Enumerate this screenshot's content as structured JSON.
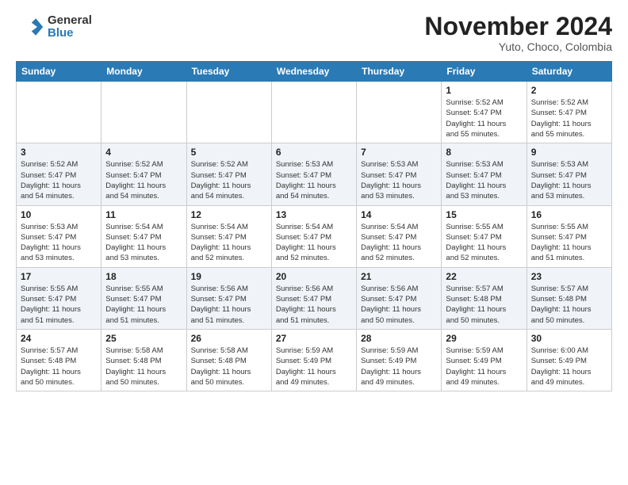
{
  "header": {
    "logo": {
      "general": "General",
      "blue": "Blue"
    },
    "title": "November 2024",
    "subtitle": "Yuto, Choco, Colombia"
  },
  "calendar": {
    "columns": [
      "Sunday",
      "Monday",
      "Tuesday",
      "Wednesday",
      "Thursday",
      "Friday",
      "Saturday"
    ],
    "weeks": [
      [
        {
          "day": "",
          "info": ""
        },
        {
          "day": "",
          "info": ""
        },
        {
          "day": "",
          "info": ""
        },
        {
          "day": "",
          "info": ""
        },
        {
          "day": "",
          "info": ""
        },
        {
          "day": "1",
          "info": "Sunrise: 5:52 AM\nSunset: 5:47 PM\nDaylight: 11 hours\nand 55 minutes."
        },
        {
          "day": "2",
          "info": "Sunrise: 5:52 AM\nSunset: 5:47 PM\nDaylight: 11 hours\nand 55 minutes."
        }
      ],
      [
        {
          "day": "3",
          "info": "Sunrise: 5:52 AM\nSunset: 5:47 PM\nDaylight: 11 hours\nand 54 minutes."
        },
        {
          "day": "4",
          "info": "Sunrise: 5:52 AM\nSunset: 5:47 PM\nDaylight: 11 hours\nand 54 minutes."
        },
        {
          "day": "5",
          "info": "Sunrise: 5:52 AM\nSunset: 5:47 PM\nDaylight: 11 hours\nand 54 minutes."
        },
        {
          "day": "6",
          "info": "Sunrise: 5:53 AM\nSunset: 5:47 PM\nDaylight: 11 hours\nand 54 minutes."
        },
        {
          "day": "7",
          "info": "Sunrise: 5:53 AM\nSunset: 5:47 PM\nDaylight: 11 hours\nand 53 minutes."
        },
        {
          "day": "8",
          "info": "Sunrise: 5:53 AM\nSunset: 5:47 PM\nDaylight: 11 hours\nand 53 minutes."
        },
        {
          "day": "9",
          "info": "Sunrise: 5:53 AM\nSunset: 5:47 PM\nDaylight: 11 hours\nand 53 minutes."
        }
      ],
      [
        {
          "day": "10",
          "info": "Sunrise: 5:53 AM\nSunset: 5:47 PM\nDaylight: 11 hours\nand 53 minutes."
        },
        {
          "day": "11",
          "info": "Sunrise: 5:54 AM\nSunset: 5:47 PM\nDaylight: 11 hours\nand 53 minutes."
        },
        {
          "day": "12",
          "info": "Sunrise: 5:54 AM\nSunset: 5:47 PM\nDaylight: 11 hours\nand 52 minutes."
        },
        {
          "day": "13",
          "info": "Sunrise: 5:54 AM\nSunset: 5:47 PM\nDaylight: 11 hours\nand 52 minutes."
        },
        {
          "day": "14",
          "info": "Sunrise: 5:54 AM\nSunset: 5:47 PM\nDaylight: 11 hours\nand 52 minutes."
        },
        {
          "day": "15",
          "info": "Sunrise: 5:55 AM\nSunset: 5:47 PM\nDaylight: 11 hours\nand 52 minutes."
        },
        {
          "day": "16",
          "info": "Sunrise: 5:55 AM\nSunset: 5:47 PM\nDaylight: 11 hours\nand 51 minutes."
        }
      ],
      [
        {
          "day": "17",
          "info": "Sunrise: 5:55 AM\nSunset: 5:47 PM\nDaylight: 11 hours\nand 51 minutes."
        },
        {
          "day": "18",
          "info": "Sunrise: 5:55 AM\nSunset: 5:47 PM\nDaylight: 11 hours\nand 51 minutes."
        },
        {
          "day": "19",
          "info": "Sunrise: 5:56 AM\nSunset: 5:47 PM\nDaylight: 11 hours\nand 51 minutes."
        },
        {
          "day": "20",
          "info": "Sunrise: 5:56 AM\nSunset: 5:47 PM\nDaylight: 11 hours\nand 51 minutes."
        },
        {
          "day": "21",
          "info": "Sunrise: 5:56 AM\nSunset: 5:47 PM\nDaylight: 11 hours\nand 50 minutes."
        },
        {
          "day": "22",
          "info": "Sunrise: 5:57 AM\nSunset: 5:48 PM\nDaylight: 11 hours\nand 50 minutes."
        },
        {
          "day": "23",
          "info": "Sunrise: 5:57 AM\nSunset: 5:48 PM\nDaylight: 11 hours\nand 50 minutes."
        }
      ],
      [
        {
          "day": "24",
          "info": "Sunrise: 5:57 AM\nSunset: 5:48 PM\nDaylight: 11 hours\nand 50 minutes."
        },
        {
          "day": "25",
          "info": "Sunrise: 5:58 AM\nSunset: 5:48 PM\nDaylight: 11 hours\nand 50 minutes."
        },
        {
          "day": "26",
          "info": "Sunrise: 5:58 AM\nSunset: 5:48 PM\nDaylight: 11 hours\nand 50 minutes."
        },
        {
          "day": "27",
          "info": "Sunrise: 5:59 AM\nSunset: 5:49 PM\nDaylight: 11 hours\nand 49 minutes."
        },
        {
          "day": "28",
          "info": "Sunrise: 5:59 AM\nSunset: 5:49 PM\nDaylight: 11 hours\nand 49 minutes."
        },
        {
          "day": "29",
          "info": "Sunrise: 5:59 AM\nSunset: 5:49 PM\nDaylight: 11 hours\nand 49 minutes."
        },
        {
          "day": "30",
          "info": "Sunrise: 6:00 AM\nSunset: 5:49 PM\nDaylight: 11 hours\nand 49 minutes."
        }
      ]
    ]
  }
}
